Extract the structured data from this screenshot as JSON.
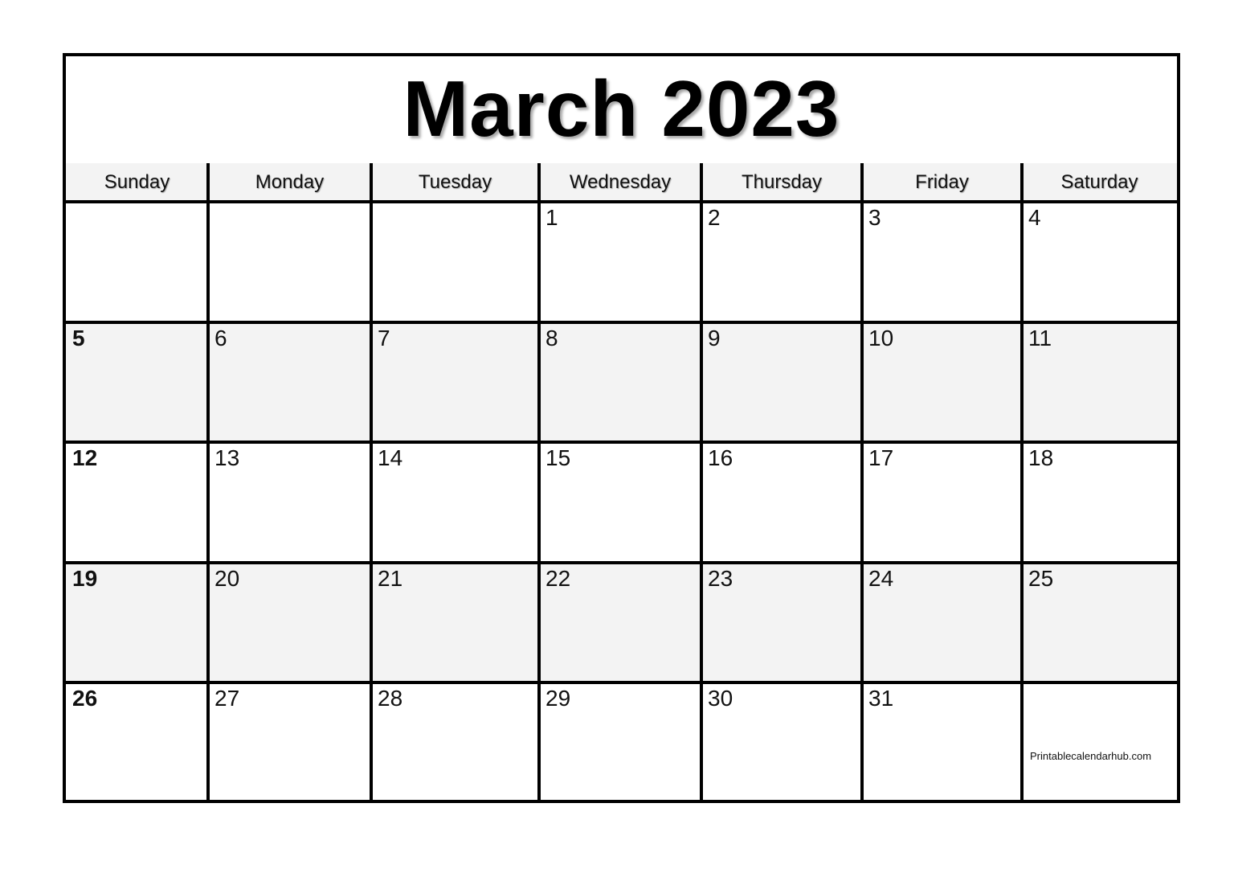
{
  "title": "March 2023",
  "weekdays": [
    "Sunday",
    "Monday",
    "Tuesday",
    "Wednesday",
    "Thursday",
    "Friday",
    "Saturday"
  ],
  "weeks": [
    [
      "",
      "",
      "",
      "1",
      "2",
      "3",
      "4"
    ],
    [
      "5",
      "6",
      "7",
      "8",
      "9",
      "10",
      "11"
    ],
    [
      "12",
      "13",
      "14",
      "15",
      "16",
      "17",
      "18"
    ],
    [
      "19",
      "20",
      "21",
      "22",
      "23",
      "24",
      "25"
    ],
    [
      "26",
      "27",
      "28",
      "29",
      "30",
      "31",
      ""
    ]
  ],
  "shaded_weeks": [
    1,
    3
  ],
  "credit": "Printablecalendarhub.com"
}
